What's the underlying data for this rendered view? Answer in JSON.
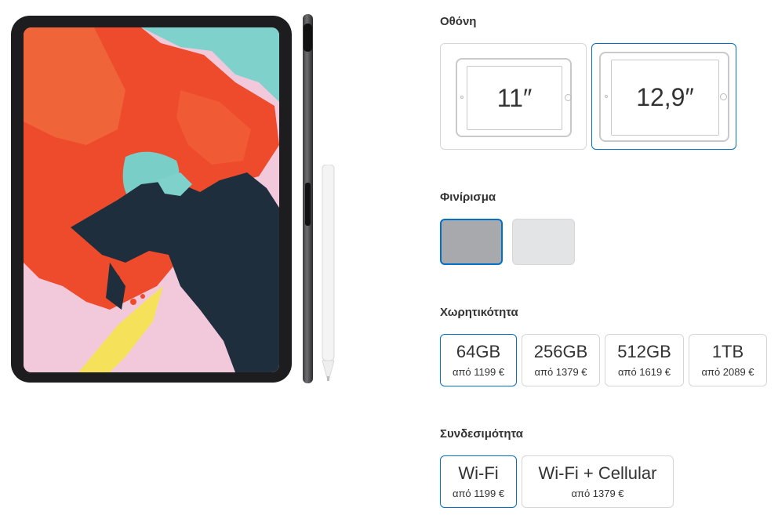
{
  "sections": {
    "display": {
      "title": "Οθόνη",
      "options": [
        {
          "label": "11″",
          "selected": false
        },
        {
          "label": "12,9″",
          "selected": true
        }
      ]
    },
    "finish": {
      "title": "Φινίρισμα",
      "options": [
        {
          "name": "space-gray",
          "color": "#a7a9ac",
          "selected": true
        },
        {
          "name": "silver",
          "color": "#e3e4e5",
          "selected": false
        }
      ]
    },
    "storage": {
      "title": "Χωρητικότητα",
      "options": [
        {
          "capacity": "64GB",
          "price": "από 1199 €",
          "selected": true
        },
        {
          "capacity": "256GB",
          "price": "από 1379 €",
          "selected": false
        },
        {
          "capacity": "512GB",
          "price": "από 1619 €",
          "selected": false
        },
        {
          "capacity": "1TB",
          "price": "από 2089 €",
          "selected": false
        }
      ]
    },
    "connectivity": {
      "title": "Συνδεσιμότητα",
      "options": [
        {
          "label": "Wi-Fi",
          "price": "από 1199 €",
          "selected": true
        },
        {
          "label": "Wi-Fi + Cellular",
          "price": "από 1379 €",
          "selected": false
        }
      ]
    }
  },
  "colors": {
    "accent": "#0070c9",
    "border": "#d6d6d6",
    "text": "#333333"
  }
}
